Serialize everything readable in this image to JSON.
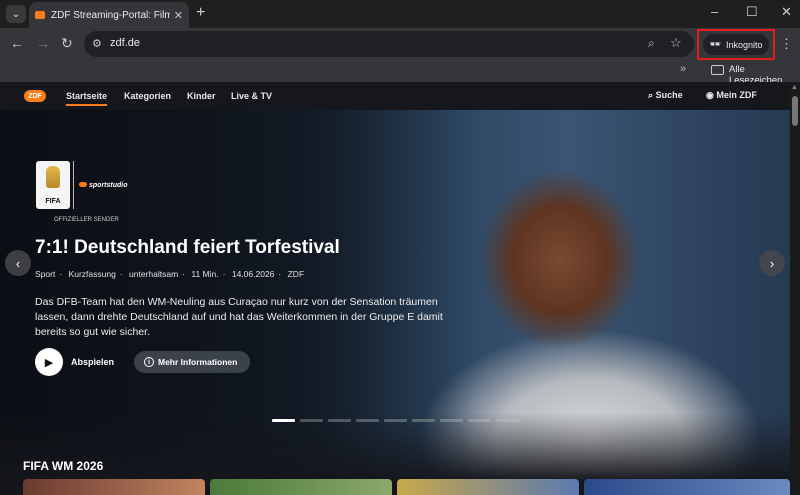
{
  "browser": {
    "tab_title": "ZDF Streaming-Portal: Filme, Se",
    "new_tab": "+",
    "url": "zdf.de",
    "incognito_label": "Inkognito",
    "bookmarks_label": "Alle Lesezeichen"
  },
  "site": {
    "logo": "ZDF",
    "nav": [
      "Startseite",
      "Kategorien",
      "Kinder",
      "Live & TV"
    ],
    "search_label": "Suche",
    "account_label": "Mein ZDF"
  },
  "hero": {
    "badge_text": "FIFA",
    "channel_text": "sportstudio",
    "official_text": "OFFIZIELLER SENDER",
    "title": "7:1! Deutschland feiert Torfestival",
    "meta": [
      "Sport",
      "·",
      "Kurzfassung",
      "·",
      "unterhaltsam",
      "·",
      "11 Min.",
      "·",
      "14.06.2026",
      "·",
      "ZDF"
    ],
    "description": "Das DFB-Team hat den WM-Neuling aus Curaçao nur kurz von der Sensation träumen lassen, dann drehte Deutschland auf und hat das Weiterkommen in der Gruppe E damit bereits so gut wie sicher.",
    "play_label": "Abspielen",
    "more_label": "Mehr Informationen",
    "slide_count": 9,
    "active_slide": 1
  },
  "section": {
    "title": "FIFA WM 2026"
  },
  "colors": {
    "accent": "#fa7d19",
    "incognito_border": "#e02020"
  }
}
